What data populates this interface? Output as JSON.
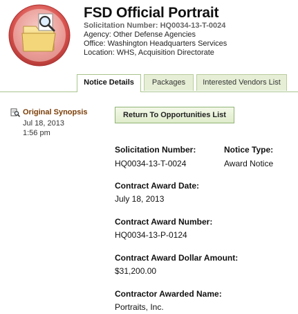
{
  "header": {
    "title": "FSD Official Portrait",
    "solicitation_line": "Solicitation Number: HQ0034-13-T-0024",
    "agency_line": "Agency: Other Defense Agencies",
    "office_line": "Office: Washington Headquarters Services",
    "location_line": "Location: WHS, Acquisition Directorate"
  },
  "tabs": [
    {
      "label": "Notice Details",
      "active": true
    },
    {
      "label": "Packages",
      "active": false
    },
    {
      "label": "Interested Vendors List",
      "active": false
    }
  ],
  "sidebar": {
    "synopsis_label": "Original Synopsis",
    "date": "Jul 18, 2013",
    "time": "1:56 pm"
  },
  "actions": {
    "return_label": "Return To Opportunities List"
  },
  "details": {
    "solicitation_number_label": "Solicitation Number:",
    "solicitation_number_value": "HQ0034-13-T-0024",
    "notice_type_label": "Notice Type:",
    "notice_type_value": "Award Notice",
    "award_date_label": "Contract Award Date:",
    "award_date_value": "July 18, 2013",
    "award_number_label": "Contract Award Number:",
    "award_number_value": "HQ0034-13-P-0124",
    "award_amount_label": "Contract Award Dollar Amount:",
    "award_amount_value": "$31,200.00",
    "awardee_label": "Contractor Awarded Name:",
    "awardee_value": "Portraits, Inc."
  },
  "colors": {
    "tab_border": "#a9c48d",
    "tab_bg": "#e6efd6",
    "link": "#7a3d06",
    "logo_ring": "#d9534f"
  },
  "icons": {
    "logo": "folder-magnifier-icon",
    "synopsis": "document-search-icon"
  }
}
